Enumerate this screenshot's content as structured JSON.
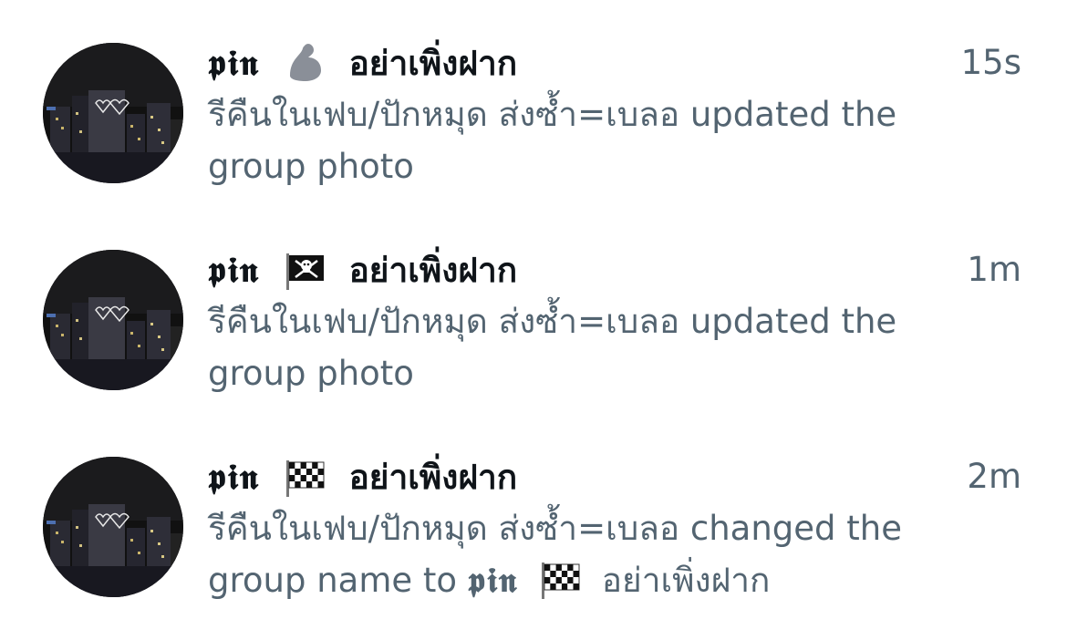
{
  "notifications": [
    {
      "name_prefix": "𝖕𝖎𝖓",
      "emoji_icon": "flexed-biceps-emoji",
      "name_suffix": "อย่าเพิ่งฝาก",
      "time": "15s",
      "line1": "รีคืนในเฟบ/ปักหมุด ส่งซ้ำ=เบลอ updated the",
      "line2": "group photo"
    },
    {
      "name_prefix": "𝖕𝖎𝖓",
      "emoji_icon": "pirate-flag-emoji",
      "name_suffix": "อย่าเพิ่งฝาก",
      "time": "1m",
      "line1": "รีคืนในเฟบ/ปักหมุด ส่งซ้ำ=เบลอ updated the",
      "line2": "group photo"
    },
    {
      "name_prefix": "𝖕𝖎𝖓",
      "emoji_icon": "checkered-flag-emoji",
      "name_suffix": "อย่าเพิ่งฝาก",
      "time": "2m",
      "line1": "รีคืนในเฟบ/ปักหมุด ส่งซ้ำ=เบลอ changed the",
      "line2_prefix": "group name to",
      "line2_pin": "𝖕𝖎𝖓",
      "line2_emoji_icon": "checkered-flag-emoji",
      "line2_suffix": "อย่าเพิ่งฝาก"
    }
  ],
  "colors": {
    "name": "#0f1419",
    "secondary": "#536471",
    "background": "#ffffff"
  }
}
